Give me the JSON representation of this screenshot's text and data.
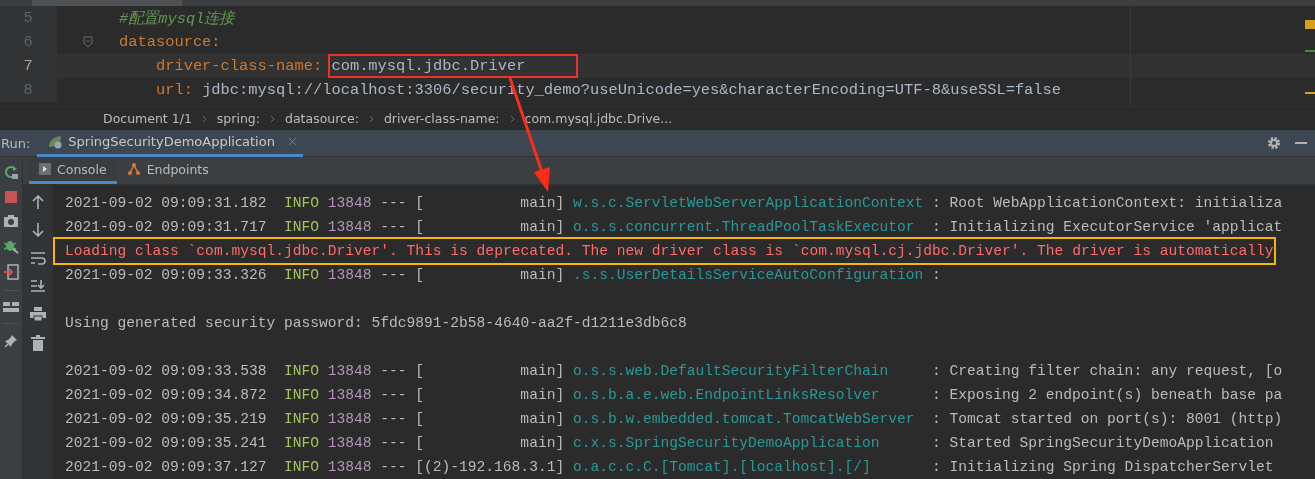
{
  "code_lines": [
    {
      "number": "5",
      "kind": "comment",
      "text": "#配置mysql连接",
      "current": false
    },
    {
      "number": "6",
      "kind": "key",
      "key": "datasource:",
      "current": false,
      "children": [
        {
          "number": "7",
          "kind": "pair",
          "key": "driver-class-name:",
          "value": "com.mysql.jdbc.Driver",
          "current": true,
          "annotated": true
        },
        {
          "number": "8",
          "kind": "pair",
          "key": "url:",
          "value": "jdbc:mysql://localhost:3306/security_demo?useUnicode=yes&characterEncoding=UTF-8&useSSL=false",
          "current": false,
          "annotated": false
        }
      ]
    }
  ],
  "breadcrumbs": [
    "Document 1/1",
    "spring:",
    "datasource:",
    "driver-class-name:",
    "com.mysql.jdbc.Drive..."
  ],
  "run_bar": {
    "label": "Run:",
    "tab": "SpringSecurityDemoApplication"
  },
  "console_tabs": [
    {
      "label": "Console",
      "selected": true
    },
    {
      "label": "Endpoints",
      "selected": false
    }
  ],
  "log_lines": [
    {
      "kind": "log",
      "timestamp": "2021-09-02 09:09:31.182",
      "level": "INFO",
      "pid": "13848",
      "separator": "---",
      "thread": "[           main]",
      "logger": "w.s.c.ServletWebServerApplicationContext",
      "message": ": Root WebApplicationContext: initializa"
    },
    {
      "kind": "log",
      "timestamp": "2021-09-02 09:09:31.717",
      "level": "INFO",
      "pid": "13848",
      "separator": "---",
      "thread": "[           main]",
      "logger": "o.s.s.concurrent.ThreadPoolTaskExecutor",
      "message": ": Initializing ExecutorService 'applicat"
    },
    {
      "kind": "error",
      "text": "Loading class `com.mysql.jdbc.Driver'. This is deprecated. The new driver class is `com.mysql.cj.jdbc.Driver'. The driver is automatically",
      "annotated": true
    },
    {
      "kind": "log",
      "timestamp": "2021-09-02 09:09:33.326",
      "level": "INFO",
      "pid": "13848",
      "separator": "---",
      "thread": "[           main]",
      "logger": ".s.s.UserDetailsServiceAutoConfiguration",
      "message": ":"
    },
    {
      "kind": "blank"
    },
    {
      "kind": "plain",
      "text": "Using generated security password: 5fdc9891-2b58-4640-aa2f-d1211e3db6c8"
    },
    {
      "kind": "blank"
    },
    {
      "kind": "log",
      "timestamp": "2021-09-02 09:09:33.538",
      "level": "INFO",
      "pid": "13848",
      "separator": "---",
      "thread": "[           main]",
      "logger": "o.s.s.web.DefaultSecurityFilterChain",
      "message": ": Creating filter chain: any request, [o"
    },
    {
      "kind": "log",
      "timestamp": "2021-09-02 09:09:34.872",
      "level": "INFO",
      "pid": "13848",
      "separator": "---",
      "thread": "[           main]",
      "logger": "o.s.b.a.e.web.EndpointLinksResolver",
      "message": ": Exposing 2 endpoint(s) beneath base pa"
    },
    {
      "kind": "log",
      "timestamp": "2021-09-02 09:09:35.219",
      "level": "INFO",
      "pid": "13848",
      "separator": "---",
      "thread": "[           main]",
      "logger": "o.s.b.w.embedded.tomcat.TomcatWebServer",
      "message": ": Tomcat started on port(s): 8001 (http)"
    },
    {
      "kind": "log",
      "timestamp": "2021-09-02 09:09:35.241",
      "level": "INFO",
      "pid": "13848",
      "separator": "---",
      "thread": "[           main]",
      "logger": "c.x.s.SpringSecurityDemoApplication",
      "message": ": Started SpringSecurityDemoApplication"
    },
    {
      "kind": "log",
      "timestamp": "2021-09-02 09:09:37.127",
      "level": "INFO",
      "pid": "13848",
      "separator": "---",
      "thread": "[(2)-192.168.3.1]",
      "logger": "o.a.c.c.C.[Tomcat].[localhost].[/]",
      "message": ": Initializing Spring DispatcherServlet"
    }
  ]
}
